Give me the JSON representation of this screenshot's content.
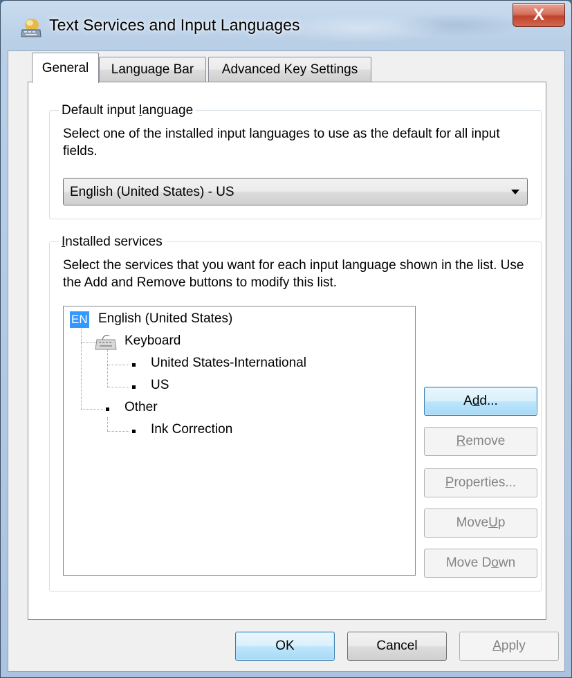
{
  "window": {
    "title": "Text Services and Input Languages",
    "close_label": "X"
  },
  "tabs": [
    {
      "label": "General",
      "active": true
    },
    {
      "label": "Language Bar",
      "active": false
    },
    {
      "label": "Advanced Key Settings",
      "active": false
    }
  ],
  "default_input": {
    "group_label_pre": "Default input ",
    "group_label_accel": "l",
    "group_label_post": "anguage",
    "description": "Select one of the installed input languages to use as the default for all input fields.",
    "selected": "English (United States) - US"
  },
  "installed_services": {
    "group_label_accel": "I",
    "group_label_post": "nstalled services",
    "description": "Select the services that you want for each input language shown in the list. Use the Add and Remove buttons to modify this list.",
    "tree": {
      "language_code": "EN",
      "language": "English (United States)",
      "keyboard_label": "Keyboard",
      "keyboards": [
        "United States-International",
        "US"
      ],
      "other_label": "Other",
      "other_items": [
        "Ink Correction"
      ]
    },
    "buttons": {
      "add": {
        "pre": "A",
        "accel": "d",
        "post": "d...",
        "enabled": true
      },
      "remove": {
        "pre": "",
        "accel": "R",
        "post": "emove",
        "enabled": false
      },
      "properties": {
        "pre": "",
        "accel": "P",
        "post": "roperties...",
        "enabled": false
      },
      "move_up": {
        "pre": "Move ",
        "accel": "U",
        "post": "p",
        "enabled": false
      },
      "move_down": {
        "pre": "Move D",
        "accel": "o",
        "post": "wn",
        "enabled": false
      }
    }
  },
  "footer": {
    "ok": "OK",
    "cancel": "Cancel",
    "apply_accel": "A",
    "apply_post": "pply"
  }
}
